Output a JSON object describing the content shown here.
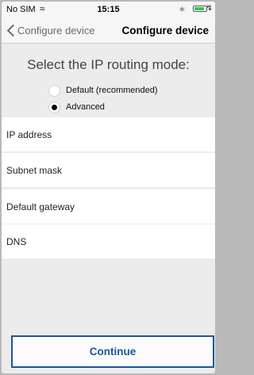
{
  "status_bar": {
    "carrier": "No SIM",
    "time": "15:15",
    "wifi_icon": "wifi-icon",
    "bluetooth_icon": "bluetooth-icon",
    "battery_icon": "battery-icon",
    "charge_icon": "charging-icon",
    "battery_level": 0.72
  },
  "nav": {
    "back_label": "Configure device",
    "title": "Configure device"
  },
  "main": {
    "prompt": "Select the IP routing mode:",
    "options": [
      {
        "label": "Default (recommended)",
        "selected": false
      },
      {
        "label": "Advanced",
        "selected": true
      }
    ],
    "fields": [
      {
        "placeholder": "IP address",
        "value": ""
      },
      {
        "placeholder": "Subnet mask",
        "value": ""
      },
      {
        "placeholder": "Default gateway",
        "value": ""
      },
      {
        "placeholder": "DNS",
        "value": ""
      }
    ],
    "continue_label": "Continue"
  },
  "colors": {
    "accent": "#1c5599",
    "background": "#ececec"
  }
}
